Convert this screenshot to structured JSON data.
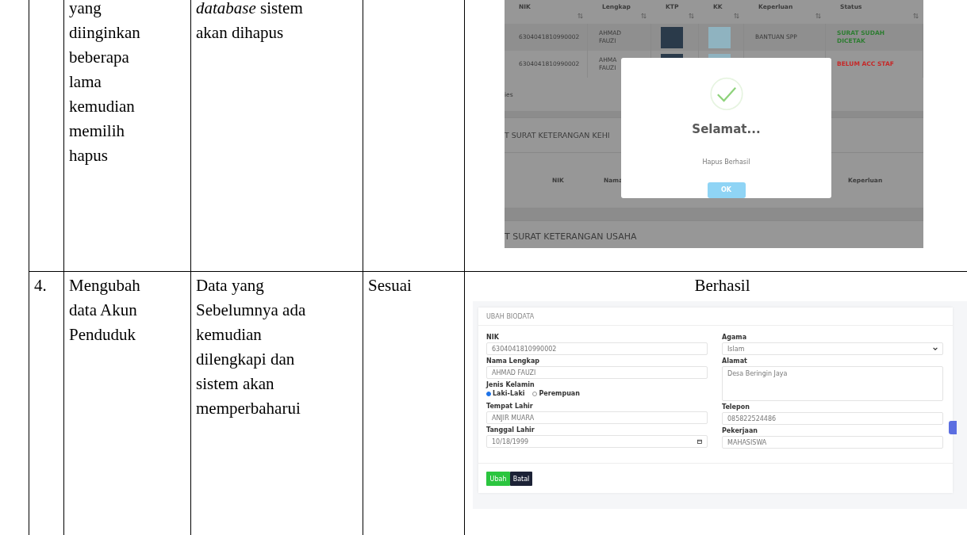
{
  "rows": [
    {
      "activity": [
        "yang",
        "diinginkan",
        "beberapa",
        "lama",
        "kemudian",
        "memilih",
        "hapus"
      ],
      "expected": [
        "*database* sistem",
        "akan dihapus"
      ],
      "evidence": {
        "kind": "delete",
        "list_table": {
          "columns": [
            "NIK",
            "Lengkap",
            "KTP",
            "KK",
            "Keperluan",
            "Status"
          ],
          "rows": [
            {
              "nik": "6304041810990002",
              "name": [
                "AHMAD",
                "FAUZI"
              ],
              "keperluan": "BANTUAN SPP",
              "status": [
                "SURAT SUDAH",
                "DICETAK"
              ],
              "color": "#2e7d32"
            },
            {
              "nik": "6304041810990002",
              "name": [
                "AHMA",
                "FAUZI"
              ],
              "status": [
                "BELUM ACC STAF"
              ],
              "color": "#c62828"
            }
          ]
        },
        "entries_text": "ies",
        "section_1": {
          "title": "T SURAT KETERANGAN KEHI",
          "columns": [
            "NIK",
            "Nama",
            "Keperluan"
          ]
        },
        "section_2": {
          "title": "T SURAT KETERANGAN USAHA"
        },
        "dialog": {
          "title": "Selamat...",
          "message": "Hapus Berhasil",
          "button": "OK"
        }
      }
    },
    {
      "number": "4.",
      "activity": [
        "Mengubah",
        "data Akun",
        "Penduduk"
      ],
      "expected": [
        "Data yang",
        "Sebelumnya ada",
        "kemudian",
        "dilengkapi dan",
        "sistem akan",
        "memperbaharui"
      ],
      "result": "Sesuai",
      "caption": "Berhasil",
      "evidence": {
        "kind": "form",
        "title": "UBAH BIODATA",
        "left_fields": [
          {
            "kind": "text",
            "label": "NIK",
            "value": "6304041810990002"
          },
          {
            "kind": "text",
            "label": "Nama Lengkap",
            "value": "AHMAD FAUZI"
          },
          {
            "kind": "radio",
            "label": "Jenis Kelamin",
            "options": [
              {
                "label": "Laki-Laki",
                "selected": true
              },
              {
                "label": "Perempuan",
                "selected": false
              }
            ]
          },
          {
            "kind": "text",
            "label": "Tempat Lahir",
            "value": "ANJIR MUARA"
          },
          {
            "kind": "date",
            "label": "Tanggal Lahir",
            "value": "10/18/1999"
          }
        ],
        "right_fields": [
          {
            "kind": "select",
            "label": "Agama",
            "value": "Islam"
          },
          {
            "kind": "textarea",
            "label": "Alamat",
            "value": "Desa Beringin Jaya"
          },
          {
            "kind": "text",
            "label": "Telepon",
            "value": "085822524486"
          },
          {
            "kind": "text",
            "label": "Pekerjaan",
            "value": "MAHASISWA"
          }
        ],
        "buttons": [
          {
            "kind": "primary",
            "label": "Ubah"
          },
          {
            "kind": "dark",
            "label": "Batal"
          }
        ]
      }
    }
  ]
}
